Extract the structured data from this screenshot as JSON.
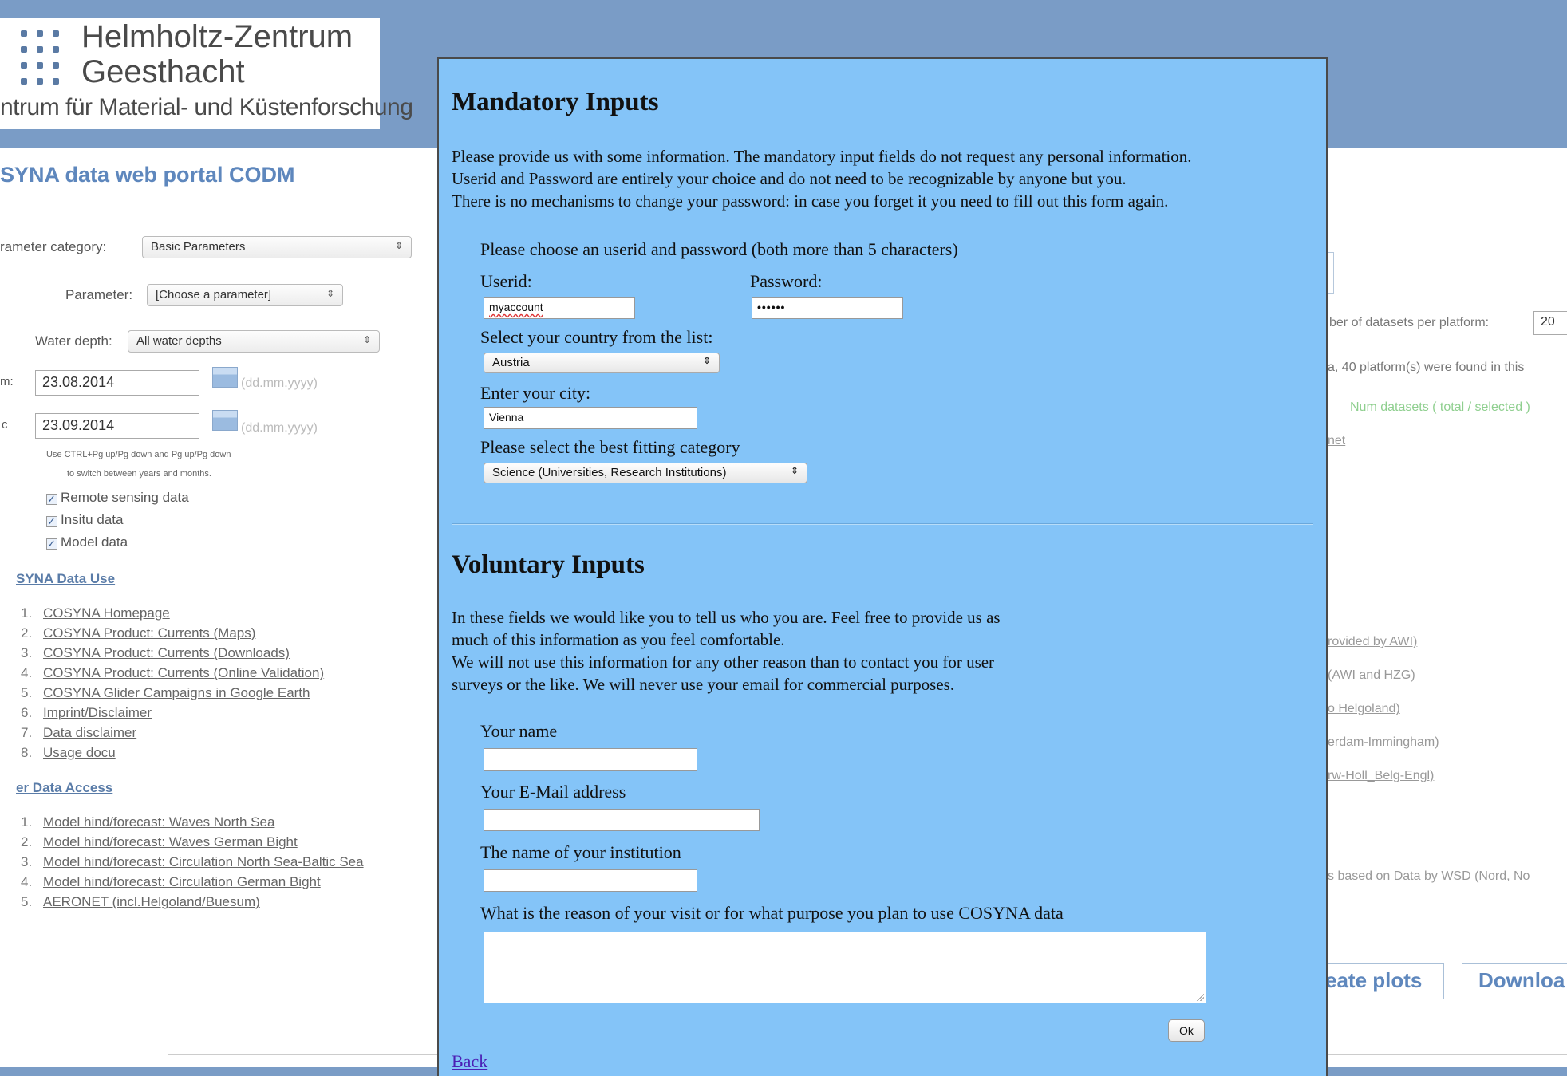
{
  "header": {
    "logo_title_line1": "Helmholtz-Zentrum",
    "logo_title_line2": "Geesthacht",
    "logo_subtitle": "ntrum für Material- und Küstenforschung"
  },
  "portal": {
    "title": "SYNA data web portal CODM",
    "filters": {
      "category_label": "rameter category:",
      "category_value": "Basic Parameters",
      "parameter_label": "Parameter:",
      "parameter_value": "[Choose a parameter]",
      "depth_label": "Water depth:",
      "depth_value": "All water depths",
      "from_label": "m:",
      "from_value": "23.08.2014",
      "to_label": "c",
      "to_value": "23.09.2014",
      "date_hint": "(dd.mm.yyyy)",
      "note_line1": "Use CTRL+Pg up/Pg down and Pg up/Pg down",
      "note_line2": "to switch between years and months."
    },
    "checkboxes": [
      {
        "label": "Remote sensing data",
        "checked": true
      },
      {
        "label": "Insitu data",
        "checked": true
      },
      {
        "label": "Model data",
        "checked": true
      }
    ],
    "data_use": {
      "heading": "SYNA Data Use",
      "links": [
        {
          "num": "1.",
          "label": "COSYNA Homepage"
        },
        {
          "num": "2.",
          "label": "COSYNA Product: Currents (Maps)"
        },
        {
          "num": "3.",
          "label": "COSYNA Product: Currents (Downloads)"
        },
        {
          "num": "4.",
          "label": "COSYNA Product: Currents (Online Validation)"
        },
        {
          "num": "5.",
          "label": "COSYNA Glider Campaigns in Google Earth"
        },
        {
          "num": "6.",
          "label": "Imprint/Disclaimer"
        },
        {
          "num": "7.",
          "label": "Data disclaimer"
        },
        {
          "num": "8.",
          "label": "Usage docu"
        }
      ]
    },
    "data_access": {
      "heading": "er Data Access",
      "links": [
        {
          "num": "1.",
          "label": "Model hind/forecast: Waves North Sea"
        },
        {
          "num": "2.",
          "label": "Model hind/forecast: Waves German Bight"
        },
        {
          "num": "3.",
          "label": "Model hind/forecast: Circulation North Sea-Baltic Sea"
        },
        {
          "num": "4.",
          "label": "Model hind/forecast: Circulation German Bight"
        },
        {
          "num": "5.",
          "label": "AERONET (incl.Helgoland/Buesum)"
        }
      ]
    },
    "right": {
      "num_datasets_label": "ber of datasets per platform:",
      "num_datasets_value": "20",
      "found_text": "a, 40 platform(s) were found in this",
      "num_datasets_green": "Num datasets ( total / selected )",
      "net_link": "net",
      "links": [
        "rovided by AWI)",
        "(AWI and HZG)",
        "o Helgoland)",
        "erdam-Immingham)",
        "rw-Holl_Belg-Engl)"
      ],
      "wsd_link": "s based on Data by WSD (Nord, No",
      "create_plots_button": "eate plots",
      "download_button": "Downloa"
    }
  },
  "modal": {
    "mandatory": {
      "title": "Mandatory Inputs",
      "intro_line1": "Please provide us with some information. The mandatory input fields do not request any personal information.",
      "intro_line2": "Userid and Password are entirely your choice and do not need to be recognizable by anyone but you.",
      "intro_line3": "There is no mechanisms to change your password: in case you forget it you need to fill out this form again.",
      "choose_prompt": "Please choose an userid and password (both more than 5 characters)",
      "userid_label": "Userid:",
      "userid_value": "myaccount",
      "password_label": "Password:",
      "password_value": "••••••",
      "country_label": "Select your country from the list:",
      "country_value": "Austria",
      "city_label": "Enter your city:",
      "city_value": "Vienna",
      "category_label": "Please select the best fitting category",
      "category_value": "Science (Universities, Research Institutions)"
    },
    "voluntary": {
      "title": "Voluntary Inputs",
      "intro_line1": "In these fields we would like you to tell us who you are. Feel free to provide us as",
      "intro_line2": "much of this information as you feel comfortable.",
      "intro_line3": "We will not use this information for any other reason than to contact you for user",
      "intro_line4": "surveys or the like. We will never use your email for commercial purposes.",
      "name_label": "Your name",
      "name_value": "",
      "email_label": "Your E-Mail address",
      "email_value": "",
      "institution_label": "The name of your institution",
      "institution_value": "",
      "reason_label": "What is the reason of your visit or for what purpose you plan to use COSYNA data",
      "reason_value": ""
    },
    "ok_button": "Ok",
    "back_link": "Back"
  },
  "icons": {
    "select_arrow": "⇕",
    "checkmark": "✓"
  }
}
